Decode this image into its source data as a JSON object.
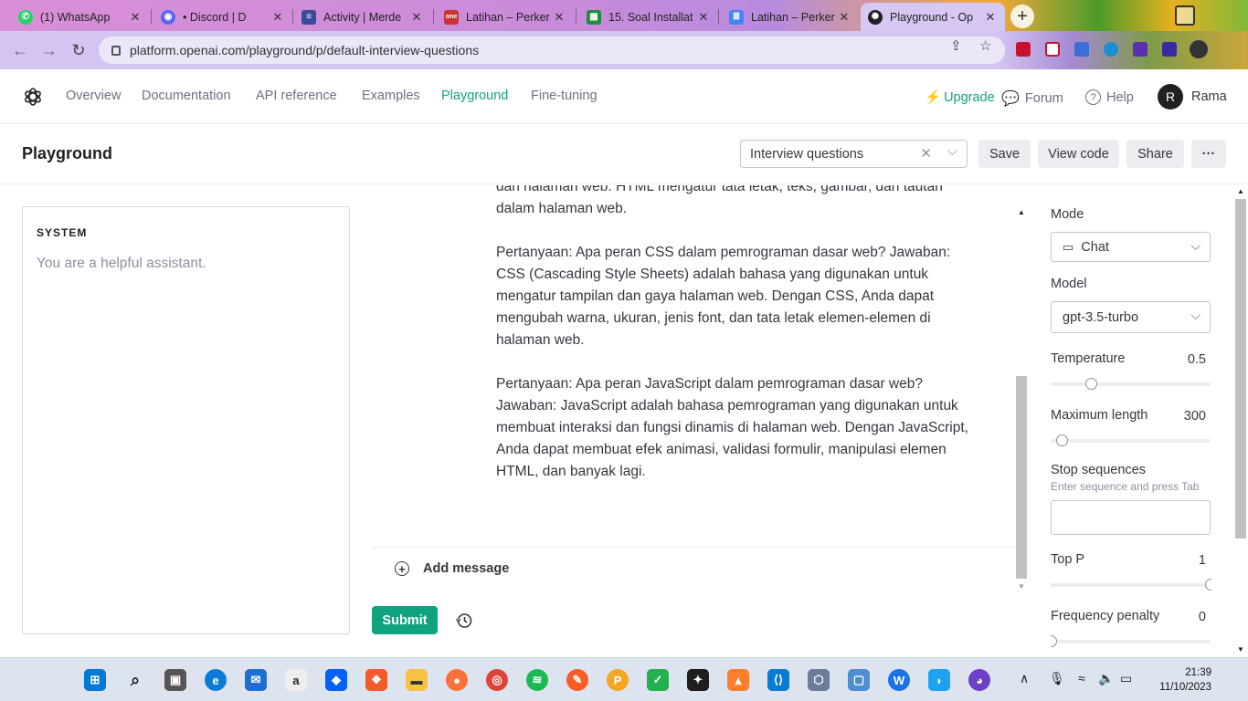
{
  "browser": {
    "tabs": [
      {
        "title": "(1) WhatsApp",
        "icon": "whatsapp-icon",
        "color": "#25d366"
      },
      {
        "title": "• Discord | D",
        "icon": "discord-icon",
        "color": "#5865f2"
      },
      {
        "title": "Activity | Merde",
        "icon": "activity-icon",
        "color": "#3b4a9a"
      },
      {
        "title": "Latihan – Perker",
        "icon": "one-icon",
        "color": "#cc3333"
      },
      {
        "title": "15. Soal Installat",
        "icon": "sheets-icon",
        "color": "#1e8e3e"
      },
      {
        "title": "Latihan – Perker",
        "icon": "docs-icon",
        "color": "#4285f4"
      },
      {
        "title": "Playground - Op",
        "icon": "openai-icon",
        "color": "#202123"
      }
    ],
    "url": "platform.openai.com/playground/p/default-interview-questions"
  },
  "nav": {
    "links": [
      "Overview",
      "Documentation",
      "API reference",
      "Examples",
      "Playground",
      "Fine-tuning"
    ],
    "active": "Playground",
    "upgrade": "Upgrade",
    "forum": "Forum",
    "help": "Help",
    "avatar_initial": "R",
    "user": "Rama"
  },
  "header": {
    "title": "Playground",
    "preset": "Interview questions",
    "save": "Save",
    "view_code": "View code",
    "share": "Share",
    "more": "···"
  },
  "system": {
    "label": "SYSTEM",
    "placeholder": "You are a helpful assistant."
  },
  "messages": {
    "paragraphs": [
      "dan halaman web. HTML mengatur tata letak, teks, gambar, dan tautan dalam halaman web.",
      "Pertanyaan: Apa peran CSS dalam pemrograman dasar web? Jawaban: CSS (Cascading Style Sheets) adalah bahasa yang digunakan untuk mengatur tampilan dan gaya halaman web. Dengan CSS, Anda dapat mengubah warna, ukuran, jenis font, dan tata letak elemen-elemen di halaman web.",
      "Pertanyaan: Apa peran JavaScript dalam pemrograman dasar web? Jawaban: JavaScript adalah bahasa pemrograman yang digunakan untuk membuat interaksi dan fungsi dinamis di halaman web. Dengan JavaScript, Anda dapat membuat efek animasi, validasi formulir, manipulasi elemen HTML, dan banyak lagi."
    ],
    "add_message": "Add message",
    "submit": "Submit"
  },
  "settings": {
    "mode_label": "Mode",
    "mode_value": "Chat",
    "model_label": "Model",
    "model_value": "gpt-3.5-turbo",
    "temperature_label": "Temperature",
    "temperature_value": "0.5",
    "max_length_label": "Maximum length",
    "max_length_value": "300",
    "stop_label": "Stop sequences",
    "stop_hint": "Enter sequence and press Tab",
    "top_p_label": "Top P",
    "top_p_value": "1",
    "freq_label": "Frequency penalty",
    "freq_value": "0",
    "slider_levels": {
      "temperature": 0.25,
      "max_length": 0.07,
      "top_p": 1.0,
      "frequency": 0.0
    }
  },
  "taskbar": {
    "time": "21:39",
    "date": "11/10/2023"
  },
  "colors": {
    "accent": "#10a37f",
    "chrome_tab_active": "#d6c7f3",
    "spell_underline": "#e0302d"
  }
}
